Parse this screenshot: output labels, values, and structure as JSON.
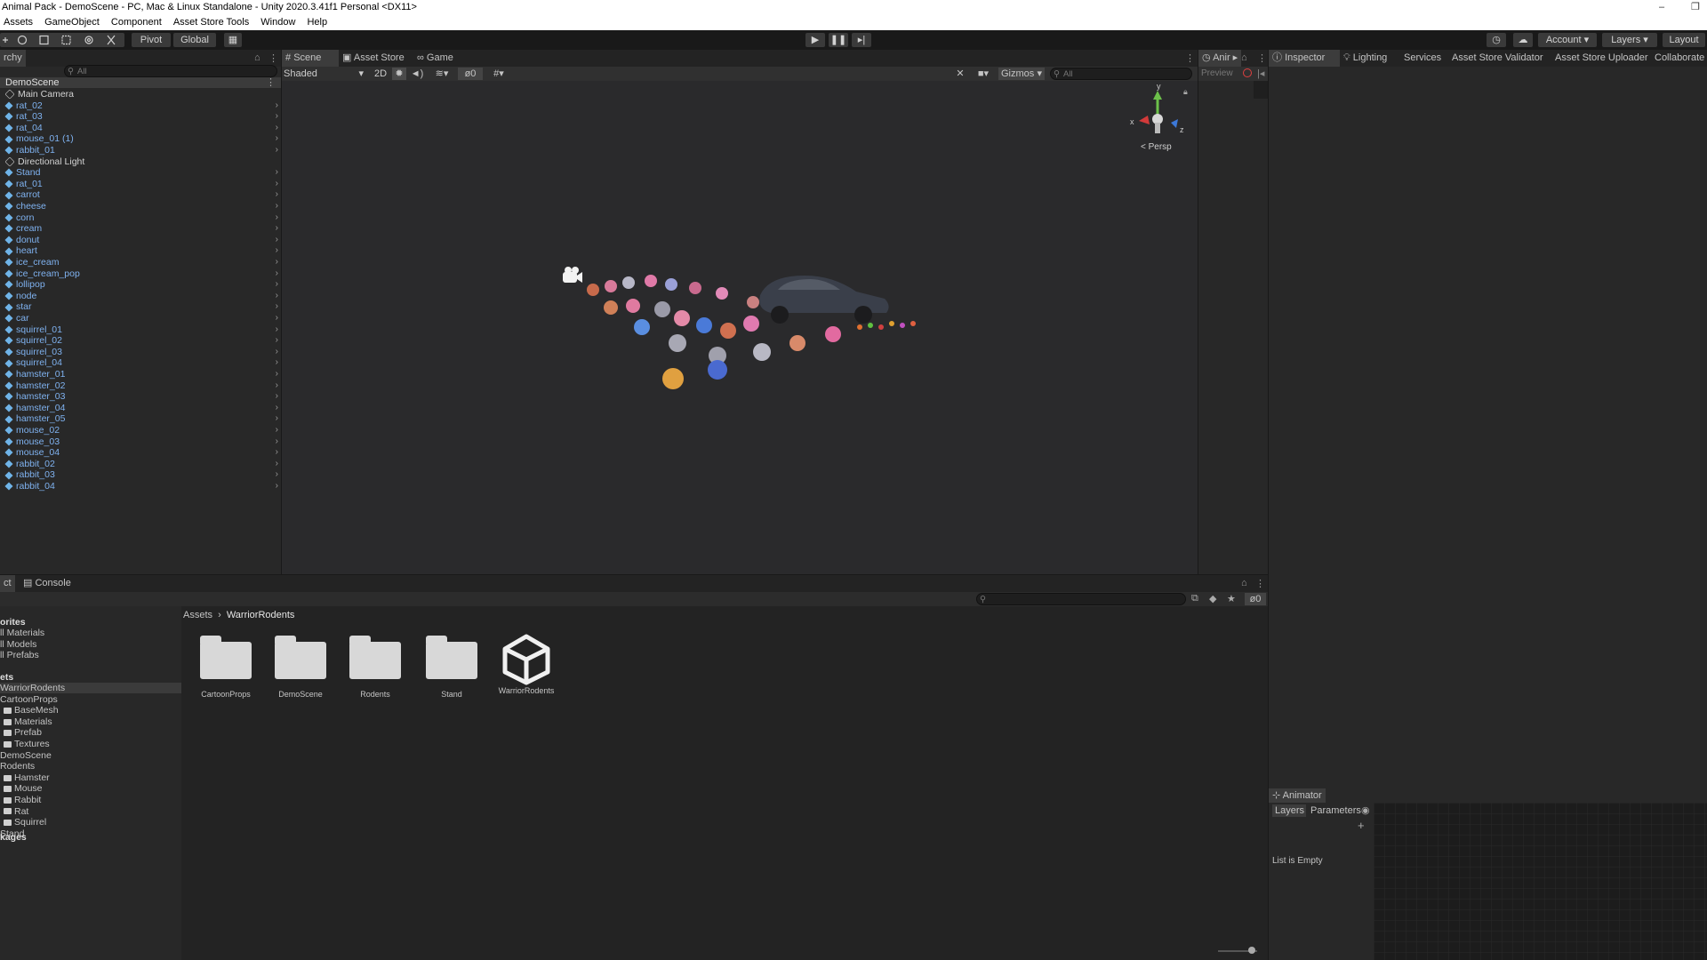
{
  "window": {
    "title": "Animal Pack - DemoScene - PC, Mac & Linux Standalone - Unity 2020.3.41f1 Personal <DX11>",
    "min_label": "–",
    "max_label": "❐"
  },
  "menu": [
    "Assets",
    "GameObject",
    "Component",
    "Asset Store Tools",
    "Window",
    "Help"
  ],
  "toolbar": {
    "pivot": "Pivot",
    "global": "Global",
    "account": "Account",
    "layers": "Layers",
    "layout": "Layout"
  },
  "hierarchy": {
    "tab": "rchy",
    "search_placeholder": "All",
    "scene": "DemoScene",
    "items": [
      {
        "name": "Main Camera",
        "type": "plain"
      },
      {
        "name": "rat_02",
        "type": "prefab"
      },
      {
        "name": "rat_03",
        "type": "prefab"
      },
      {
        "name": "rat_04",
        "type": "prefab"
      },
      {
        "name": "mouse_01 (1)",
        "type": "prefab"
      },
      {
        "name": "rabbit_01",
        "type": "prefab"
      },
      {
        "name": "Directional Light",
        "type": "plain"
      },
      {
        "name": "Stand",
        "type": "prefab"
      },
      {
        "name": "rat_01",
        "type": "prefab"
      },
      {
        "name": "carrot",
        "type": "prefab"
      },
      {
        "name": "cheese",
        "type": "prefab"
      },
      {
        "name": "corn",
        "type": "prefab"
      },
      {
        "name": "cream",
        "type": "prefab"
      },
      {
        "name": "donut",
        "type": "prefab"
      },
      {
        "name": "heart",
        "type": "prefab"
      },
      {
        "name": "ice_cream",
        "type": "prefab"
      },
      {
        "name": "ice_cream_pop",
        "type": "prefab"
      },
      {
        "name": "lollipop",
        "type": "prefab"
      },
      {
        "name": "node",
        "type": "prefab"
      },
      {
        "name": "star",
        "type": "prefab"
      },
      {
        "name": "car",
        "type": "prefab"
      },
      {
        "name": "squirrel_01",
        "type": "prefab"
      },
      {
        "name": "squirrel_02",
        "type": "prefab"
      },
      {
        "name": "squirrel_03",
        "type": "prefab"
      },
      {
        "name": "squirrel_04",
        "type": "prefab"
      },
      {
        "name": "hamster_01",
        "type": "prefab"
      },
      {
        "name": "hamster_02",
        "type": "prefab"
      },
      {
        "name": "hamster_03",
        "type": "prefab"
      },
      {
        "name": "hamster_04",
        "type": "prefab"
      },
      {
        "name": "hamster_05",
        "type": "prefab"
      },
      {
        "name": "mouse_02",
        "type": "prefab"
      },
      {
        "name": "mouse_03",
        "type": "prefab"
      },
      {
        "name": "mouse_04",
        "type": "prefab"
      },
      {
        "name": "rabbit_02",
        "type": "prefab"
      },
      {
        "name": "rabbit_03",
        "type": "prefab"
      },
      {
        "name": "rabbit_04",
        "type": "prefab"
      }
    ]
  },
  "scene": {
    "tabs": [
      "Scene",
      "Asset Store",
      "Game"
    ],
    "shading": "Shaded",
    "mode_2d": "2D",
    "hidden_count": "0",
    "gizmos": "Gizmos",
    "search_placeholder": "All",
    "persp": "< Persp",
    "axis_x": "x",
    "axis_y": "y",
    "axis_z": "z"
  },
  "anim_panel": {
    "tab": "Anir",
    "preview": "Preview"
  },
  "inspector_tabs": [
    "Inspector",
    "Lighting",
    "Services",
    "Asset Store Validator",
    "Asset Store Uploader",
    "Collaborate"
  ],
  "bottom": {
    "tabs": [
      "ct",
      "Console"
    ],
    "badge": "0",
    "breadcrumb_root": "Assets",
    "breadcrumb_current": "WarriorRodents",
    "favorites": {
      "header": "orites",
      "items": [
        "ll Materials",
        "ll Models",
        "ll Prefabs"
      ]
    },
    "assets_header": "ets",
    "tree": [
      {
        "name": "WarriorRodents",
        "indent": 0,
        "selected": true
      },
      {
        "name": "CartoonProps",
        "indent": 0
      },
      {
        "name": "BaseMesh",
        "indent": 1
      },
      {
        "name": "Materials",
        "indent": 1
      },
      {
        "name": "Prefab",
        "indent": 1
      },
      {
        "name": "Textures",
        "indent": 1
      },
      {
        "name": "DemoScene",
        "indent": 0
      },
      {
        "name": "Rodents",
        "indent": 0
      },
      {
        "name": "Hamster",
        "indent": 1
      },
      {
        "name": "Mouse",
        "indent": 1
      },
      {
        "name": "Rabbit",
        "indent": 1
      },
      {
        "name": "Rat",
        "indent": 1
      },
      {
        "name": "Squirrel",
        "indent": 1
      },
      {
        "name": "Stand",
        "indent": 0
      }
    ],
    "packages": "kages",
    "assets": [
      "CartoonProps",
      "DemoScene",
      "Rodents",
      "Stand",
      "WarriorRodents"
    ]
  },
  "animator": {
    "title": "Animator",
    "tabs": [
      "Layers",
      "Parameters"
    ],
    "empty": "List is Empty"
  }
}
